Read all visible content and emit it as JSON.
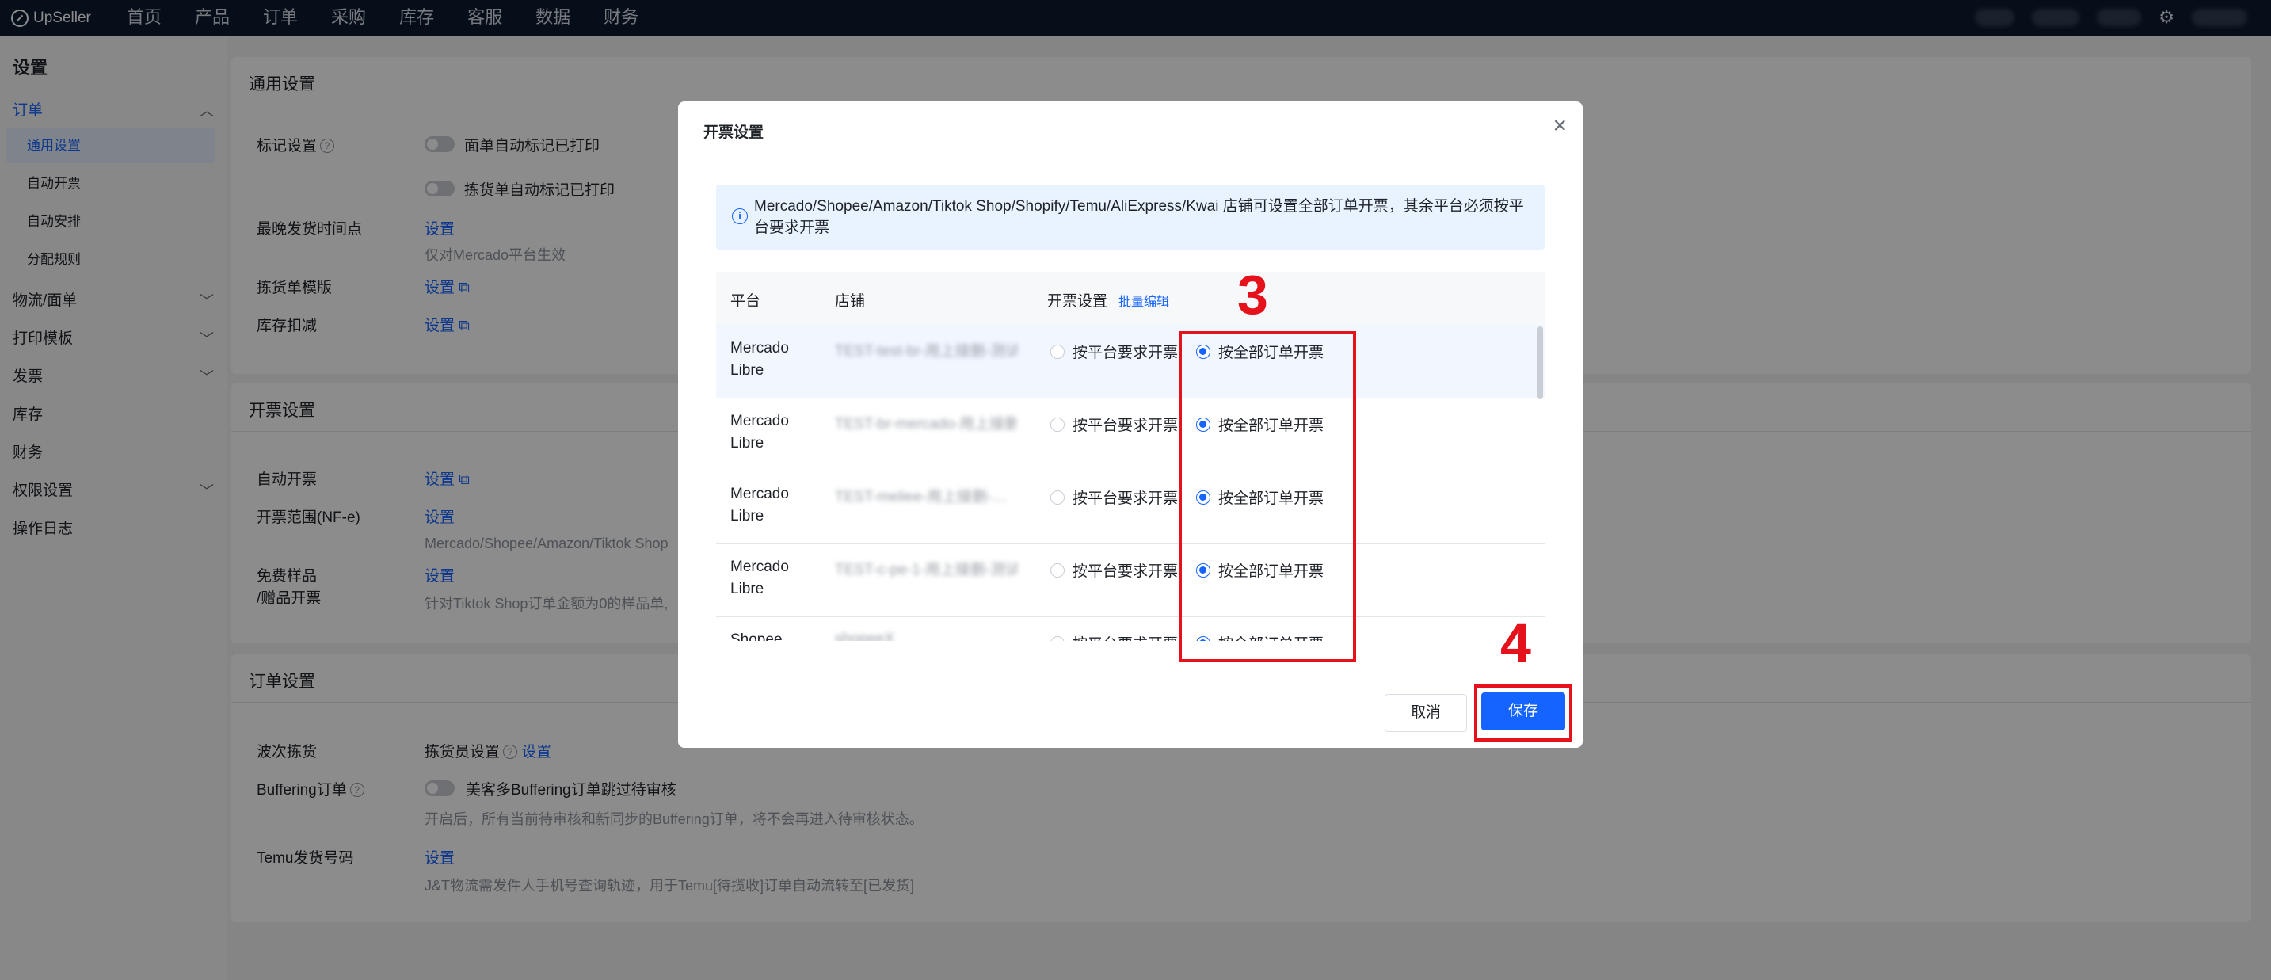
{
  "app": {
    "logo": "UpSeller"
  },
  "topnav": [
    "首页",
    "产品",
    "订单",
    "采购",
    "库存",
    "客服",
    "数据",
    "财务"
  ],
  "sidebar": {
    "title": "设置",
    "items": [
      {
        "label": "订单"
      },
      {
        "label": "通用设置"
      },
      {
        "label": "自动开票"
      },
      {
        "label": "自动安排"
      },
      {
        "label": "分配规则"
      },
      {
        "label": "物流/面单"
      },
      {
        "label": "打印模板"
      },
      {
        "label": "发票"
      },
      {
        "label": "库存"
      },
      {
        "label": "财务"
      },
      {
        "label": "权限设置"
      },
      {
        "label": "操作日志"
      }
    ]
  },
  "general": {
    "title": "通用设置",
    "mark_label": "标记设置",
    "toggle1": "面单自动标记已打印",
    "toggle2": "拣货单自动标记已打印",
    "ship_label": "最晚发货时间点",
    "ship_link": "设置",
    "ship_hint": "仅对Mercado平台生效",
    "pick_label": "拣货单模版",
    "pick_link": "设置",
    "stock_label": "库存扣减",
    "stock_link": "设置"
  },
  "invoice": {
    "title": "开票设置",
    "auto_label": "自动开票",
    "auto_link": "设置",
    "range_label": "开票范围(NF-e)",
    "range_link": "设置",
    "range_hint": "Mercado/Shopee/Amazon/Tiktok Shop",
    "free_label1": "免费样品",
    "free_label2": "/赠品开票",
    "free_link": "设置",
    "free_hint": "针对Tiktok Shop订单金额为0的样品单,"
  },
  "order": {
    "title": "订单设置",
    "wave_label": "波次拣货",
    "wave_value": "拣货员设置",
    "wave_link": "设置",
    "buffer_label": "Buffering订单",
    "buffer_toggle": "美客多Buffering订单跳过待审核",
    "buffer_hint": "开启后，所有当前待审核和新同步的Buffering订单，将不会再进入待审核状态。",
    "temu_label": "Temu发货号码",
    "temu_link": "设置",
    "temu_hint": "J&T物流需发件人手机号查询轨迹，用于Temu[待揽收]订单自动流转至[已发货]"
  },
  "modal": {
    "title": "开票设置",
    "notice": "Mercado/Shopee/Amazon/Tiktok Shop/Shopify/Temu/AliExpress/Kwai 店铺可设置全部订单开票，其余平台必须按平台要求开票",
    "col_platform": "平台",
    "col_shop": "店铺",
    "col_setting": "开票设置",
    "batch_edit": "批量编辑",
    "option_platform": "按平台要求开票",
    "option_all": "按全部订单开票",
    "rows": [
      {
        "platform": "Mercado Libre",
        "shop": "TEST-test-br-用上接删-测试",
        "selected": "all"
      },
      {
        "platform": "Mercado Libre",
        "shop": "TEST-br-mercado-用上接删…",
        "selected": "all"
      },
      {
        "platform": "Mercado Libre",
        "shop": "TEST-meliee-用上接删-…",
        "selected": "all"
      },
      {
        "platform": "Mercado Libre",
        "shop": "TEST-c-pe-1-用上接删-测试",
        "selected": "all"
      },
      {
        "platform": "Shopee",
        "shop": "shopeeX",
        "selected": "all"
      }
    ],
    "cancel": "取消",
    "save": "保存"
  },
  "annotations": {
    "step3": "3",
    "step4": "4"
  }
}
